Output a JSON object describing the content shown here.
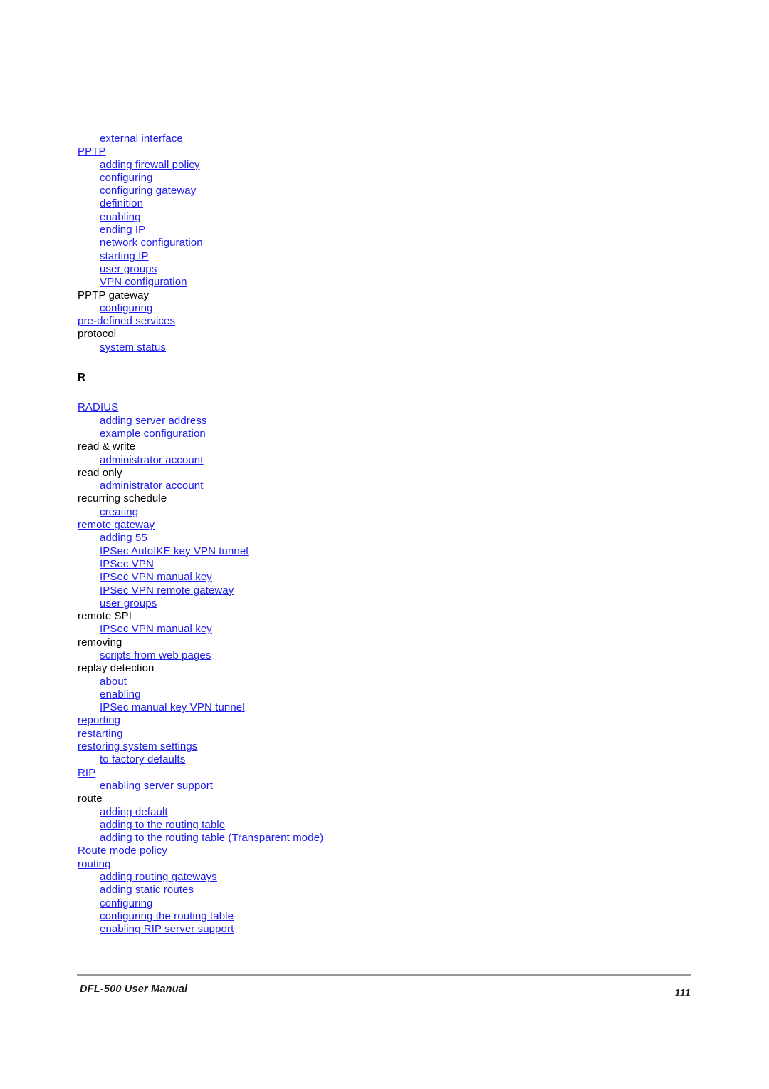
{
  "document": {
    "footer_left": "DFL-500 User Manual",
    "page_number": "111",
    "link_color": "#1a1aee",
    "text_color": "#000000",
    "rule_color": "#9a9a9a"
  },
  "index": {
    "entries": [
      {
        "label": "external interface",
        "level": 1,
        "link": true
      },
      {
        "label": "PPTP",
        "level": 0,
        "link": true
      },
      {
        "label": "adding firewall policy",
        "level": 1,
        "link": true
      },
      {
        "label": "configuring",
        "level": 1,
        "link": true
      },
      {
        "label": "configuring gateway",
        "level": 1,
        "link": true
      },
      {
        "label": "definition",
        "level": 1,
        "link": true
      },
      {
        "label": "enabling",
        "level": 1,
        "link": true
      },
      {
        "label": "ending IP",
        "level": 1,
        "link": true
      },
      {
        "label": "network configuration",
        "level": 1,
        "link": true
      },
      {
        "label": "starting IP",
        "level": 1,
        "link": true
      },
      {
        "label": "user groups",
        "level": 1,
        "link": true
      },
      {
        "label": "VPN configuration",
        "level": 1,
        "link": true
      },
      {
        "label": "PPTP gateway",
        "level": 0,
        "link": false
      },
      {
        "label": "configuring",
        "level": 1,
        "link": true
      },
      {
        "label": "pre-defined services",
        "level": 0,
        "link": true
      },
      {
        "label": "protocol",
        "level": 0,
        "link": false
      },
      {
        "label": "system status",
        "level": 1,
        "link": true
      }
    ],
    "section_heading": "R",
    "entries_r": [
      {
        "label": "RADIUS",
        "level": 0,
        "link": true
      },
      {
        "label": "adding server address",
        "level": 1,
        "link": true
      },
      {
        "label": "example configuration",
        "level": 1,
        "link": true
      },
      {
        "label": "read & write",
        "level": 0,
        "link": false
      },
      {
        "label": "administrator account",
        "level": 1,
        "link": true
      },
      {
        "label": "read only",
        "level": 0,
        "link": false
      },
      {
        "label": "administrator account",
        "level": 1,
        "link": true
      },
      {
        "label": "recurring schedule",
        "level": 0,
        "link": false
      },
      {
        "label": "creating",
        "level": 1,
        "link": true
      },
      {
        "label": "remote gateway",
        "level": 0,
        "link": true
      },
      {
        "label": "adding 55",
        "level": 1,
        "link": true
      },
      {
        "label": "IPSec AutoIKE key VPN tunnel",
        "level": 1,
        "link": true
      },
      {
        "label": "IPSec VPN",
        "level": 1,
        "link": true
      },
      {
        "label": "IPSec VPN manual key",
        "level": 1,
        "link": true
      },
      {
        "label": "IPSec VPN remote gateway",
        "level": 1,
        "link": true
      },
      {
        "label": "user groups",
        "level": 1,
        "link": true
      },
      {
        "label": "remote SPI",
        "level": 0,
        "link": false
      },
      {
        "label": "IPSec VPN manual key",
        "level": 1,
        "link": true
      },
      {
        "label": "removing",
        "level": 0,
        "link": false
      },
      {
        "label": "scripts from web pages",
        "level": 1,
        "link": true
      },
      {
        "label": "replay detection",
        "level": 0,
        "link": false
      },
      {
        "label": "about",
        "level": 1,
        "link": true
      },
      {
        "label": "enabling",
        "level": 1,
        "link": true
      },
      {
        "label": "IPSec manual key VPN tunnel",
        "level": 1,
        "link": true
      },
      {
        "label": "reporting",
        "level": 0,
        "link": true
      },
      {
        "label": "restarting",
        "level": 0,
        "link": true
      },
      {
        "label": "restoring system settings",
        "level": 0,
        "link": true
      },
      {
        "label": "to factory defaults",
        "level": 1,
        "link": true
      },
      {
        "label": "RIP",
        "level": 0,
        "link": true
      },
      {
        "label": "enabling server support",
        "level": 1,
        "link": true
      },
      {
        "label": "route",
        "level": 0,
        "link": false
      },
      {
        "label": "adding default",
        "level": 1,
        "link": true
      },
      {
        "label": "adding to the routing table",
        "level": 1,
        "link": true
      },
      {
        "label": "adding to the routing table (Transparent mode)",
        "level": 1,
        "link": true
      },
      {
        "label": "Route mode policy",
        "level": 0,
        "link": true
      },
      {
        "label": "routing",
        "level": 0,
        "link": true
      },
      {
        "label": "adding routing gateways",
        "level": 1,
        "link": true
      },
      {
        "label": "adding static routes",
        "level": 1,
        "link": true
      },
      {
        "label": "configuring",
        "level": 1,
        "link": true
      },
      {
        "label": "configuring the routing table",
        "level": 1,
        "link": true
      },
      {
        "label": "enabling RIP server support",
        "level": 1,
        "link": true
      }
    ]
  }
}
